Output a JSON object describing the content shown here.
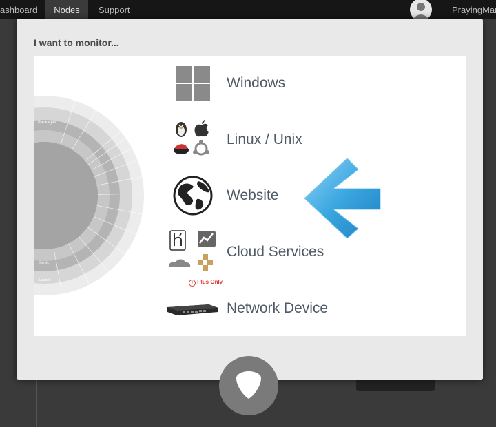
{
  "topnav": {
    "items": [
      {
        "label": "ashboard"
      },
      {
        "label": "Nodes",
        "active": true
      },
      {
        "label": "Support"
      }
    ],
    "user": "PrayingMan"
  },
  "modal": {
    "title": "I want to monitor...",
    "options": [
      {
        "label": "Windows",
        "icon": "windows-icon"
      },
      {
        "label": "Linux / Unix",
        "icon": "linux-unix-icons"
      },
      {
        "label": "Website",
        "icon": "globe-icon"
      },
      {
        "label": "Cloud Services",
        "icon": "cloud-services-icons"
      },
      {
        "label": "Network Device",
        "icon": "network-switch-icon",
        "badge": "Plus Only"
      }
    ],
    "sunburst": {
      "segment_labels": [
        "Packages",
        "Servic",
        "Launch"
      ]
    }
  },
  "colors": {
    "accent_arrow": "#3aa6e0",
    "modal_bg": "#e9e9e9",
    "topbar_bg": "#161616",
    "badge_red": "#dd3333"
  }
}
